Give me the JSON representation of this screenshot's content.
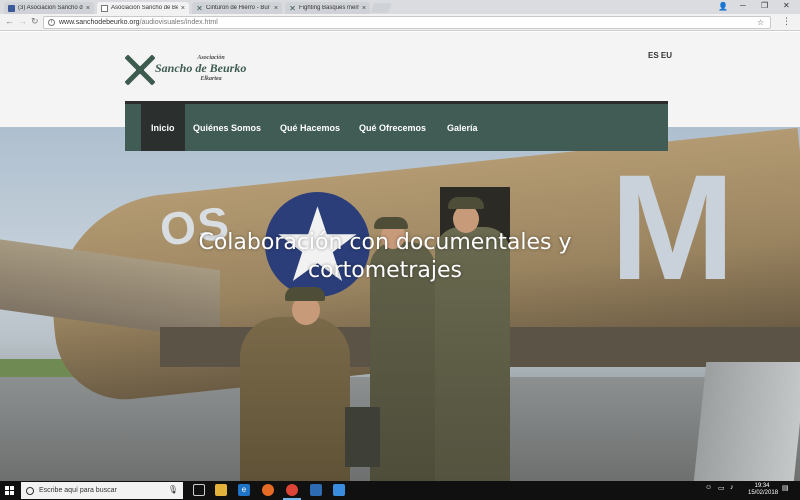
{
  "browser": {
    "tabs": [
      {
        "title": "(3) Asociación Sancho de",
        "active": false,
        "favicon": "facebook-icon"
      },
      {
        "title": "Asociación Sancho de Be",
        "active": true,
        "favicon": "document-icon"
      },
      {
        "title": "Cinturon de Hierro - Bur",
        "active": false,
        "favicon": "cross-logo-icon"
      },
      {
        "title": "Fighting Basques memo",
        "active": false,
        "favicon": "cross-logo-icon"
      }
    ],
    "close_glyph": "×",
    "url_main": "www.sanchodebeurko.org",
    "url_path": "/audiovisuales/index.html"
  },
  "site": {
    "logo": {
      "line1": "Asociación",
      "line2": "Sancho de Beurko",
      "line3": "Elkartea"
    },
    "lang": "ES EU",
    "nav": [
      {
        "label": "Inicio",
        "active": true
      },
      {
        "label": "Quiénes Somos",
        "active": false
      },
      {
        "label": "Qué Hacemos",
        "active": false
      },
      {
        "label": "Qué Ofrecemos",
        "active": false
      },
      {
        "label": "Galería",
        "active": false
      }
    ],
    "hero_caption": "Colaboración con documentales y cortometrajes",
    "colors": {
      "nav_bg": "#405c55",
      "nav_active": "#2b2f2d",
      "brand": "#3d5b4f"
    }
  },
  "taskbar": {
    "search_placeholder": "Escribe aquí para buscar",
    "time": "19:34",
    "date": "15/02/2018"
  }
}
